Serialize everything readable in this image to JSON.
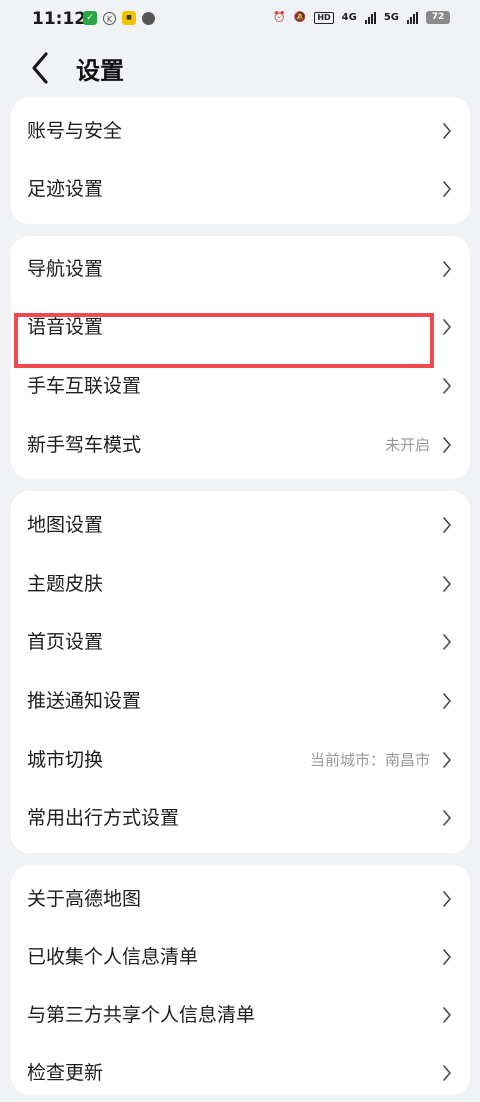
{
  "status_bar": {
    "time": "11:12",
    "battery": "72",
    "hd": "HD",
    "net1": "4G",
    "net2": "5G"
  },
  "header": {
    "title": "设置"
  },
  "groups": [
    {
      "items": [
        {
          "label": "账号与安全",
          "value": ""
        },
        {
          "label": "足迹设置",
          "value": ""
        }
      ]
    },
    {
      "items": [
        {
          "label": "导航设置",
          "value": ""
        },
        {
          "label": "语音设置",
          "value": ""
        },
        {
          "label": "手车互联设置",
          "value": ""
        },
        {
          "label": "新手驾车模式",
          "value": "未开启"
        }
      ]
    },
    {
      "items": [
        {
          "label": "地图设置",
          "value": ""
        },
        {
          "label": "主题皮肤",
          "value": ""
        },
        {
          "label": "首页设置",
          "value": ""
        },
        {
          "label": "推送通知设置",
          "value": ""
        },
        {
          "label": "城市切换",
          "value": "当前城市：南昌市"
        },
        {
          "label": "常用出行方式设置",
          "value": ""
        }
      ]
    },
    {
      "items": [
        {
          "label": "关于高德地图",
          "value": ""
        },
        {
          "label": "已收集个人信息清单",
          "value": ""
        },
        {
          "label": "与第三方共享个人信息清单",
          "value": ""
        },
        {
          "label": "检查更新",
          "value": ""
        }
      ]
    }
  ],
  "colors": {
    "background": "#f1f2f6",
    "card": "#ffffff",
    "highlight": "#ee4a4f"
  }
}
